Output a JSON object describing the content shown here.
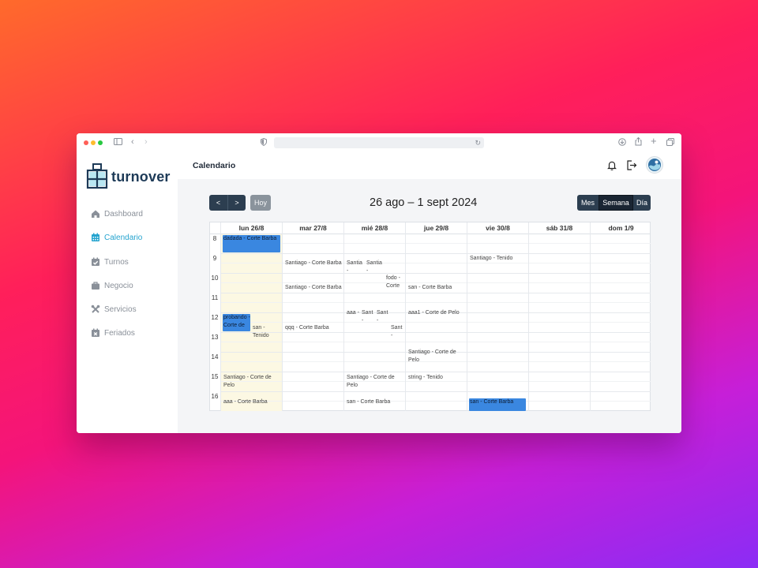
{
  "app": {
    "name": "turnover",
    "page_title": "Calendario"
  },
  "browser": {
    "url": ""
  },
  "sidebar": {
    "items": [
      {
        "label": "Dashboard",
        "icon": "home-icon"
      },
      {
        "label": "Calendario",
        "icon": "calendar-icon"
      },
      {
        "label": "Turnos",
        "icon": "calendar-check-icon"
      },
      {
        "label": "Negocio",
        "icon": "briefcase-icon"
      },
      {
        "label": "Servicios",
        "icon": "tools-icon"
      },
      {
        "label": "Feriados",
        "icon": "calendar-x-icon"
      }
    ]
  },
  "toolbar": {
    "prev_label": "<",
    "next_label": ">",
    "today_label": "Hoy",
    "range_title": "26 ago – 1 sept 2024",
    "views": [
      "Mes",
      "Semana",
      "Día"
    ],
    "active_view": "Semana"
  },
  "calendar": {
    "days": [
      "lun 26/8",
      "mar 27/8",
      "mié 28/8",
      "jue 29/8",
      "vie 30/8",
      "sáb 31/8",
      "dom 1/9"
    ],
    "hours": [
      "8",
      "9",
      "10",
      "11",
      "12",
      "13",
      "14",
      "15",
      "16"
    ],
    "events": {
      "mon_0800": "dadada - Corte Barba",
      "mon_1200": "probando - Corte de",
      "mon_1230": "san - Tenido",
      "mon_1500": "Santiago - Corte de Pelo",
      "mon_1600": "aaa - Corte Barba",
      "tue_0900": "Santiago - Corte Barba",
      "tue_1000": "Santiago - Corte Barba",
      "tue_1230": "qqq - Corte Barba",
      "wed_0900a": "Santia -",
      "wed_0900b": "Santia -",
      "wed_0930": "fodo - Corte",
      "wed_1200a": "aaa -",
      "wed_1200b": "Sant -",
      "wed_1200c": "Sant -",
      "wed_1230": "Sant -",
      "wed_1500": "Santiago - Corte de Pelo",
      "wed_1600": "san - Corte Barba",
      "thu_1000": "san - Corte Barba",
      "thu_1200": "aaa1 - Corte de Pelo",
      "thu_1330": "Santiago - Corte de Pelo",
      "thu_1500": "string - Tenido",
      "fri_0900": "Santiago - Tenido",
      "fri_1600": "san - Corte Barba"
    }
  },
  "colors": {
    "accent": "#26a4cf",
    "button_dark": "#2c3e50",
    "event_blue": "#3a87e0",
    "today_bg": "#fcf8e3"
  }
}
